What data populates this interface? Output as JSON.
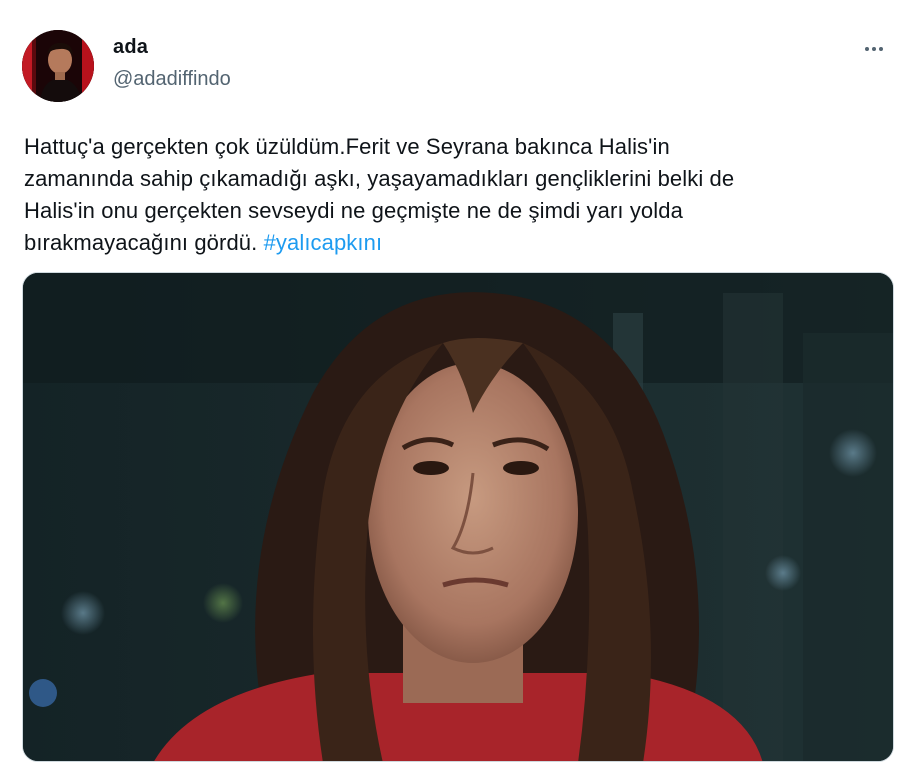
{
  "tweet": {
    "author": {
      "display_name": "ada",
      "handle": "@adadiffindo",
      "avatar_icon": "profile-photo"
    },
    "more_icon": "more-horizontal-icon",
    "text_lines": [
      "Hattuç'a gerçekten çok üzüldüm.Ferit ve Seyrana bakınca Halis'in",
      "zamanında sahip çıkamadığı aşkı, yaşayamadıkları gençliklerini belki de",
      "Halis'in onu gerçekten sevseydi ne geçmişte ne de şimdi yarı yolda",
      "bırakmayacağını gördü."
    ],
    "hashtag": "#yalıcapkını",
    "colors": {
      "text": "#0f1419",
      "secondary": "#536471",
      "link": "#1d9bf0",
      "border": "#cfd9de"
    }
  }
}
